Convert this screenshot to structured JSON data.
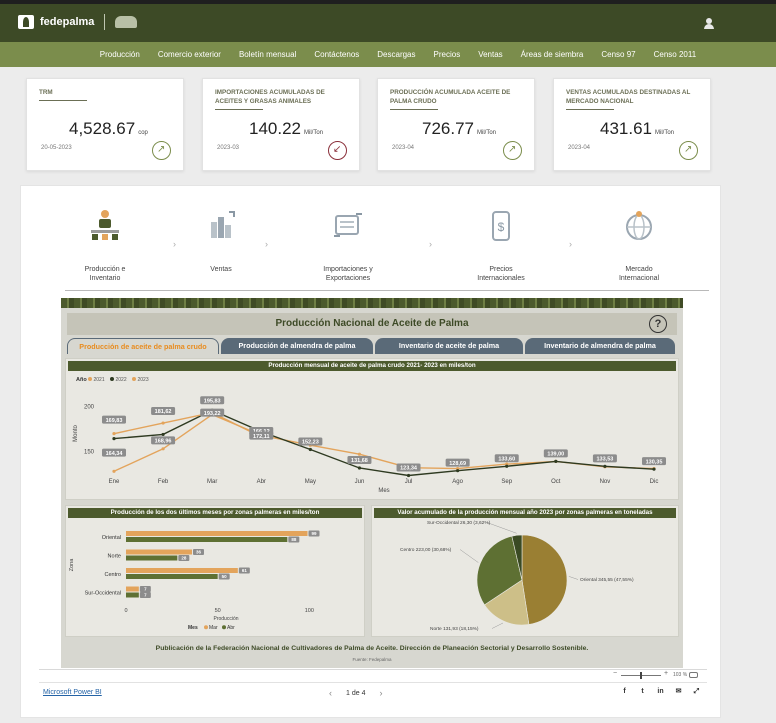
{
  "brand": {
    "name": "fedepalma"
  },
  "nav": [
    "Producción",
    "Comercio exterior",
    "Boletín mensual",
    "Contáctenos",
    "Descargas",
    "Precios",
    "Ventas",
    "Áreas de siembra",
    "Censo 97",
    "Censo 2011"
  ],
  "kpis": [
    {
      "title": "TRM",
      "value": "4,528.67",
      "unit": "cop",
      "date": "20-05-2023",
      "trend": "up"
    },
    {
      "title": "IMPORTACIONES ACUMULADAS DE ACEITES Y GRASAS ANIMALES",
      "value": "140.22",
      "unit": "Mil/Ton",
      "date": "2023-03",
      "trend": "down"
    },
    {
      "title": "PRODUCCIÓN ACUMULADA ACEITE DE PALMA CRUDO",
      "value": "726.77",
      "unit": "Mil/Ton",
      "date": "2023-04",
      "trend": "up"
    },
    {
      "title": "VENTAS ACUMULADAS DESTINADAS AL MERCADO NACIONAL",
      "value": "431.61",
      "unit": "Mil/Ton",
      "date": "2023-04",
      "trend": "up"
    }
  ],
  "steps": [
    {
      "label_1": "Producción e",
      "label_2": "Inventario",
      "icon": "factory-icon"
    },
    {
      "label_1": "Ventas",
      "label_2": "",
      "icon": "cart-icon"
    },
    {
      "label_1": "Importaciones y",
      "label_2": "Exportaciones",
      "icon": "ship-icon"
    },
    {
      "label_1": "Precios",
      "label_2": "Internacionales",
      "icon": "price-tag-icon"
    },
    {
      "label_1": "Mercado",
      "label_2": "Internacional",
      "icon": "globe-icon"
    }
  ],
  "report": {
    "title": "Producción Nacional de Aceite de Palma",
    "help": "?",
    "tabs": [
      "Producción de aceite de palma crudo",
      "Producción de almendra de palma",
      "Inventario de aceite de palma",
      "Inventario de almendra de palma"
    ],
    "active_tab": 0,
    "footnote": "Publicación de la Federación Nacional de Cultivadores de Palma de Aceite. Dirección de Planeación Sectorial y Desarrollo Sostenible.",
    "source": "Fuente: Fedepalma"
  },
  "chart_data": [
    {
      "type": "line",
      "title": "Producción mensual de aceite de palma crudo 2021- 2023 en miles/ton",
      "xlabel": "Mes",
      "ylabel": "Monto",
      "legend_title": "Año",
      "legend_position": "top-left",
      "categories": [
        "Ene",
        "Feb",
        "Mar",
        "Abr",
        "May",
        "Jun",
        "Jul",
        "Ago",
        "Sep",
        "Oct",
        "Nov",
        "Dic"
      ],
      "yticks": [
        150,
        200
      ],
      "ylim": [
        125,
        215
      ],
      "series": [
        {
          "name": "2021",
          "color": "#e3a45c",
          "values": [
            128,
            153,
            191,
            168,
            157,
            147,
            132,
            131,
            136,
            139,
            133,
            131
          ]
        },
        {
          "name": "2022",
          "color": "#2e3a21",
          "values": [
            164.34,
            168.96,
            195.83,
            172.11,
            152.23,
            131.68,
            123.34,
            128.69,
            133.6,
            139.0,
            133.53,
            130.35
          ]
        },
        {
          "name": "2023",
          "color": "#e3a45c",
          "values": [
            169.83,
            181.62,
            193.22,
            166.12,
            null,
            null,
            null,
            null,
            null,
            null,
            null,
            null
          ]
        }
      ],
      "data_labels": [
        {
          "x": "Ene",
          "text": "169,83",
          "value": 169.83
        },
        {
          "x": "Ene",
          "text": "164,34",
          "value": 164.34
        },
        {
          "x": "Feb",
          "text": "181,62",
          "value": 181.62
        },
        {
          "x": "Feb",
          "text": "168,96",
          "value": 168.96
        },
        {
          "x": "Mar",
          "text": "195,83",
          "value": 195.83
        },
        {
          "x": "Mar",
          "text": "193,22",
          "value": 193.22
        },
        {
          "x": "Abr",
          "text": "166,12",
          "value": 166.12
        },
        {
          "x": "Abr",
          "text": "172,11",
          "value": 172.11
        },
        {
          "x": "May",
          "text": "152,23",
          "value": 152.23
        },
        {
          "x": "Jun",
          "text": "131,68",
          "value": 131.68
        },
        {
          "x": "Jul",
          "text": "123,34",
          "value": 123.34
        },
        {
          "x": "Ago",
          "text": "128,69",
          "value": 128.69
        },
        {
          "x": "Sep",
          "text": "133,60",
          "value": 133.6
        },
        {
          "x": "Oct",
          "text": "139,00",
          "value": 139.0
        },
        {
          "x": "Nov",
          "text": "133,53",
          "value": 133.53
        },
        {
          "x": "Dic",
          "text": "130,35",
          "value": 130.35
        }
      ]
    },
    {
      "type": "bar",
      "orientation": "horizontal",
      "title": "Producción de los dos últimos meses por zonas palmeras en miles/ton",
      "xlabel": "Producción",
      "ylabel": "Zona",
      "legend_title": "Mes",
      "legend_position": "bottom",
      "categories": [
        "Oriental",
        "Norte",
        "Centro",
        "Sur-Occidental"
      ],
      "xlim": [
        0,
        120
      ],
      "xticks": [
        0,
        50,
        100
      ],
      "series": [
        {
          "name": "Mar",
          "color": "#e3a45c",
          "values": [
            99,
            36,
            61,
            7
          ]
        },
        {
          "name": "Abr",
          "color": "#5e7033",
          "values": [
            88,
            28,
            50,
            7
          ]
        }
      ]
    },
    {
      "type": "pie",
      "title": "Valor acumulado de la producción mensual año 2023 por zonas palmeras en toneladas",
      "slices": [
        {
          "label": "Oriental",
          "value": 345.55,
          "text": "Oriental 345,55 (47,55%)",
          "color": "#9a7f33"
        },
        {
          "label": "Norte",
          "value": 131.93,
          "text": "Norte 131,93 (18,15%)",
          "color": "#cdbf88"
        },
        {
          "label": "Centro",
          "value": 223.0,
          "text": "Centro 223,00 (30,68%)",
          "color": "#5e7033"
        },
        {
          "label": "Sur-Occidental",
          "value": 26.3,
          "text": "Sur-Occidental 26,30 (3,62%)",
          "color": "#3a4a23"
        }
      ]
    }
  ],
  "zoom": {
    "percent": "103 %",
    "minus": "−",
    "plus": "+"
  },
  "footer": {
    "powerbi_link": "Microsoft Power BI",
    "page": "1 de 4",
    "share": [
      "f",
      "t",
      "in",
      "✉",
      "⤢"
    ]
  }
}
